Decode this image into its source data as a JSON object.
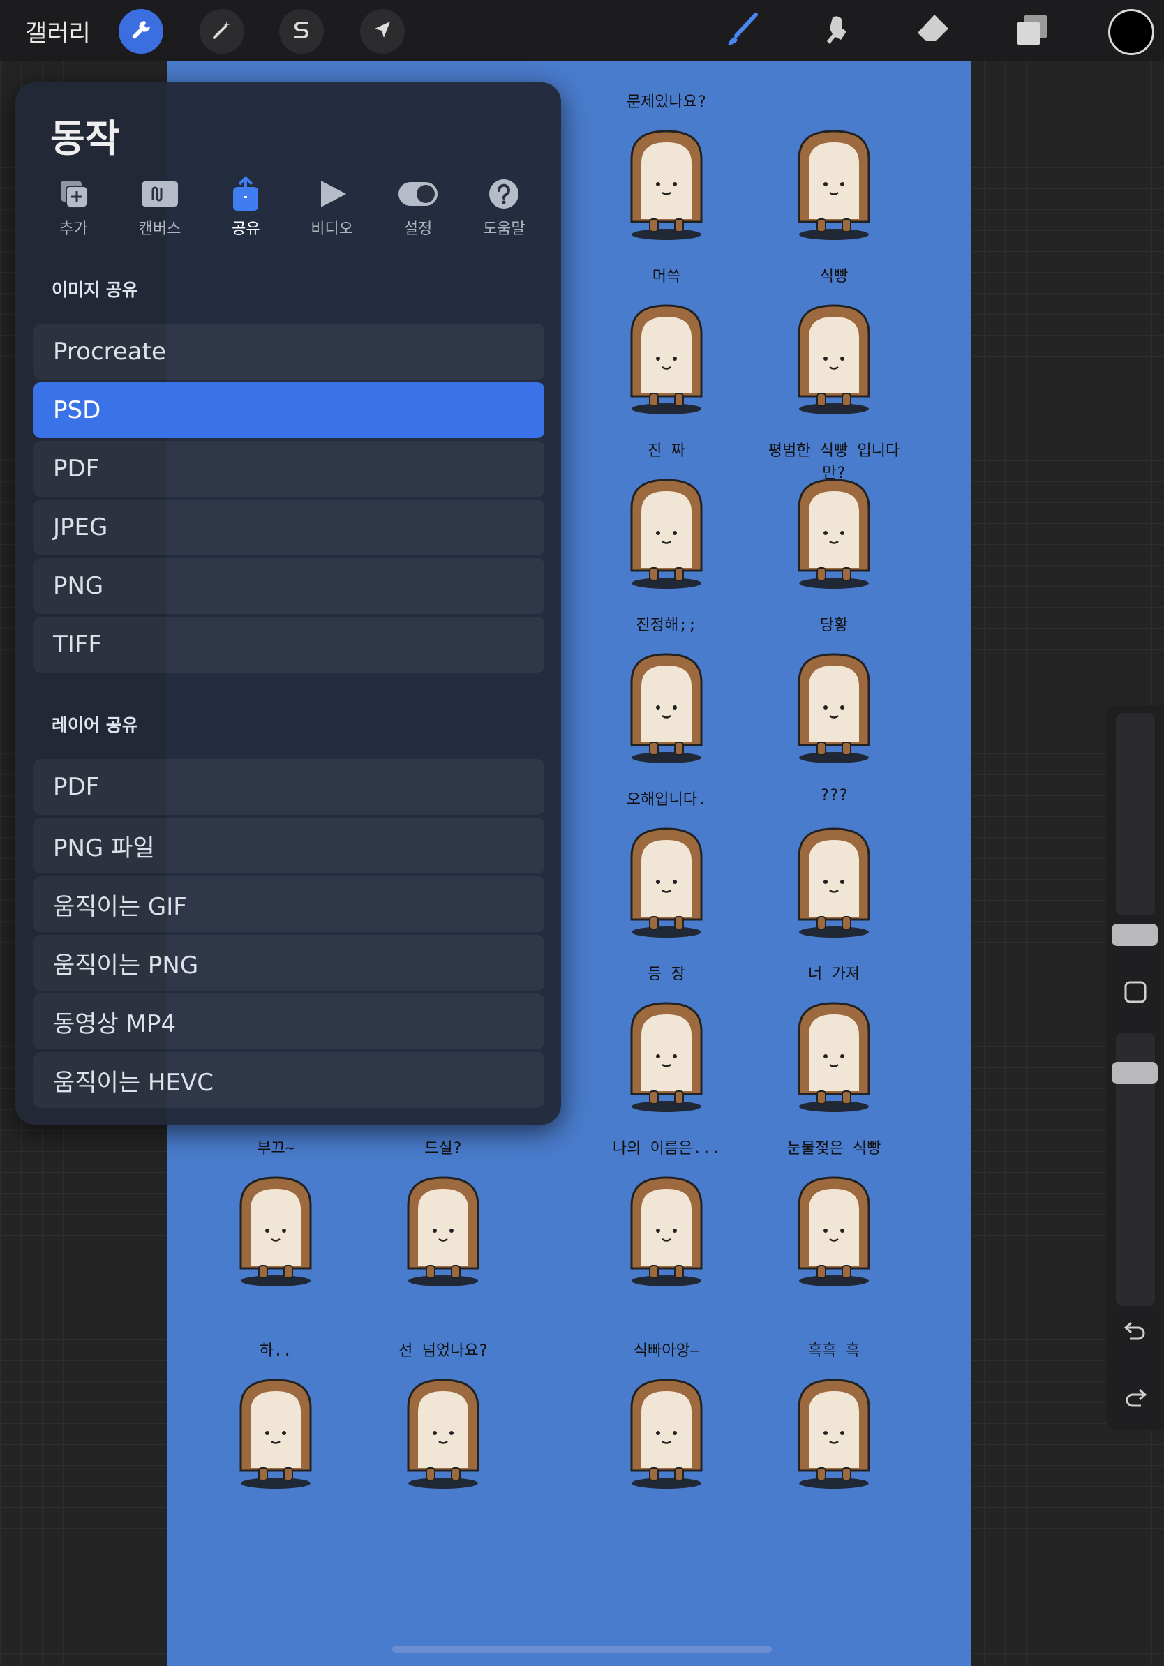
{
  "topbar": {
    "gallery_label": "갤러리",
    "tools_left": [
      "wrench-icon",
      "magic-wand-icon",
      "selection-s-icon",
      "transform-arrow-icon"
    ],
    "tools_right": [
      "brush-icon",
      "smudge-icon",
      "eraser-icon",
      "layers-icon"
    ],
    "current_color": "#000000",
    "active_color": "#3b6fe0"
  },
  "panel": {
    "title": "동작",
    "tabs": [
      {
        "label": "추가",
        "icon": "add-image-icon"
      },
      {
        "label": "캔버스",
        "icon": "canvas-icon"
      },
      {
        "label": "공유",
        "icon": "share-icon"
      },
      {
        "label": "비디오",
        "icon": "play-icon"
      },
      {
        "label": "설정",
        "icon": "toggle-icon"
      },
      {
        "label": "도움말",
        "icon": "help-icon"
      }
    ],
    "active_tab": "공유",
    "image_share_header": "이미지 공유",
    "image_share": [
      "Procreate",
      "PSD",
      "PDF",
      "JPEG",
      "PNG",
      "TIFF"
    ],
    "selected_item": "PSD",
    "layer_share_header": "레이어 공유",
    "layer_share": [
      "PDF",
      "PNG 파일",
      "움직이는 GIF",
      "움직이는 PNG",
      "동영상 MP4",
      "움직이는 HEVC"
    ]
  },
  "canvas": {
    "background": "#4a7ccd",
    "captions": [
      "문제있나요?",
      "",
      "머쓱",
      "식빵",
      "진  짜",
      "평범한 식빵 입니다만?",
      "진정해;;",
      "당황",
      "오해입니다.",
      "???",
      "등  장",
      "너 가져",
      "부끄~",
      "드실?",
      "나의 이름은...",
      "눈물젖은 식빵",
      "하..",
      "선 넘었나요?",
      "식빠아앙—",
      "흑흑 흑"
    ]
  },
  "sidebar": {
    "buttons": [
      "square-modify-icon",
      "undo-icon",
      "redo-icon"
    ]
  }
}
